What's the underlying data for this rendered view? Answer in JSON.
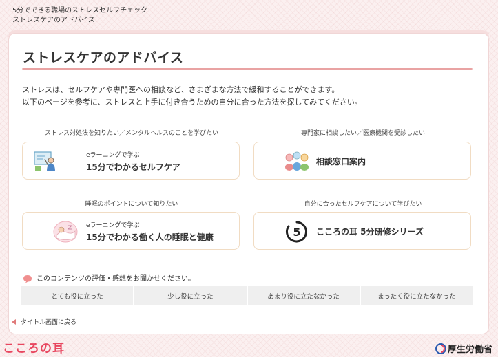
{
  "breadcrumb": {
    "line1": "5分でできる職場のストレスセルフチェック",
    "line2": "ストレスケアのアドバイス"
  },
  "page_title": "ストレスケアのアドバイス",
  "intro": {
    "line1": "ストレスは、セルフケアや専門医への相談など、さまざまな方法で緩和することができます。",
    "line2": "以下のページを参考に、ストレスと上手に付き合うための自分に合った方法を探してみてください。"
  },
  "cards": [
    {
      "caption": "ストレス対処法を知りたい／メンタルヘルスのことを学びたい",
      "small": "eラーニングで学ぶ",
      "big": "15分でわかるセルフケア",
      "icon": "elearning-person-icon"
    },
    {
      "caption": "専門家に相談したい／医療機関を受診したい",
      "big": "相談窓口案内",
      "icon": "consultation-people-icon"
    },
    {
      "caption": "睡眠のポイントについて知りたい",
      "small": "eラーニングで学ぶ",
      "big": "15分でわかる働く人の睡眠と健康",
      "icon": "sleep-bed-icon"
    },
    {
      "caption": "自分に合ったセルフケアについて学びたい",
      "big": "こころの耳 5分研修シリーズ",
      "icon": "five-minute-clock-icon"
    }
  ],
  "rating": {
    "question": "このコンテンツの評価・感想をお聞かせください。",
    "options": [
      "とても役に立った",
      "少し役に立った",
      "あまり役に立たなかった",
      "まったく役に立たなかった"
    ]
  },
  "back_link": "タイトル画面に戻る",
  "footer": {
    "brand": "こころの耳",
    "ministry": "厚生労働省"
  },
  "colors": {
    "accent": "#e9a3a3",
    "brand": "#e8465f",
    "card_border": "#f1dcc3",
    "background": "#fbf0f0"
  }
}
